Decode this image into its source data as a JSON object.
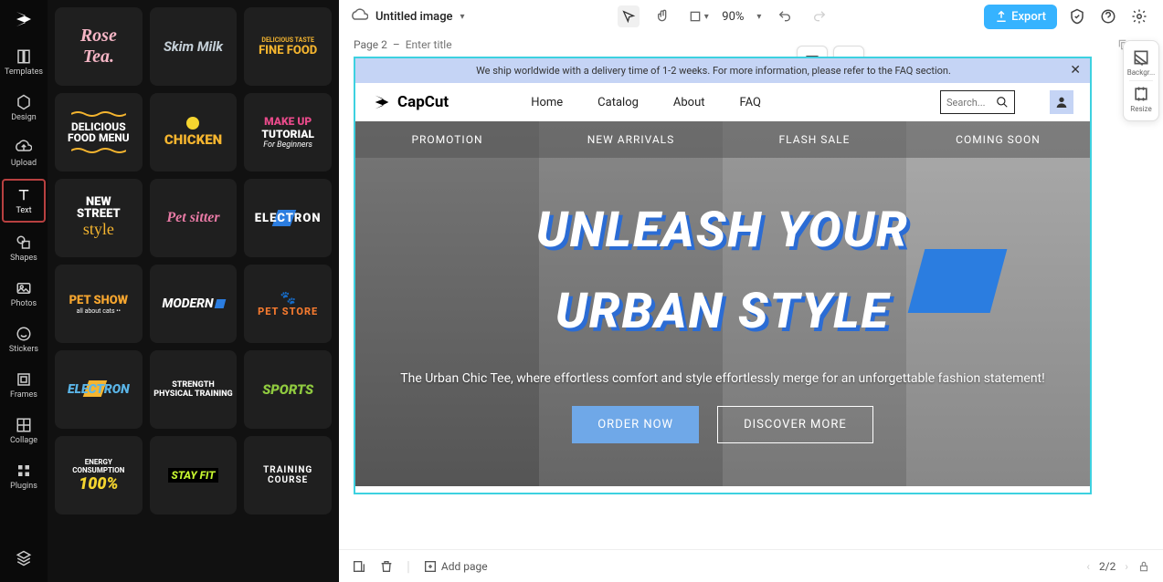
{
  "nav": {
    "templates": "Templates",
    "design": "Design",
    "upload": "Upload",
    "text": "Text",
    "shapes": "Shapes",
    "photos": "Photos",
    "stickers": "Stickers",
    "frames": "Frames",
    "collage": "Collage",
    "plugins": "Plugins"
  },
  "tiles": [
    {
      "l1": "Rose",
      "l2": "Tea.",
      "cls": "t-rose"
    },
    {
      "l1": "Skim Milk",
      "cls": "t-skim"
    },
    {
      "pre": "DELICIOUS TASTE",
      "l1": "FINE FOOD",
      "preCls": "t-fine-sm",
      "cls": "t-fine"
    },
    {
      "l1": "DELICIOUS",
      "l2": "FOOD MENU",
      "cls": "t-deli",
      "wave": true
    },
    {
      "l1": "CHICKEN",
      "cls": "t-chick",
      "egg": true
    },
    {
      "l1": "MAKE UP",
      "l2": "TUTORIAL",
      "l3": "For Beginners",
      "cls": "t-make",
      "cls2": "t-tut",
      "cls3": "t-beg"
    },
    {
      "l1": "NEW",
      "l2": "STREET",
      "l3": "style",
      "cls": "t-street",
      "cls3": "t-style"
    },
    {
      "l1": "Pet sitter",
      "cls": "t-pet"
    },
    {
      "l1": "ELECTRON",
      "cls": "t-elec",
      "slash": "#2b7de0"
    },
    {
      "l1": "PET SHOW",
      "l2": "all about cats ••",
      "cls": "t-petshow",
      "cls2": "t-petshow-sm"
    },
    {
      "l1": "MODERN",
      "cls": "t-modern",
      "sq": "#2b7de0"
    },
    {
      "l1": "PET STORE",
      "cls": "t-petstore",
      "paw": true
    },
    {
      "l1": "ELECTRON",
      "cls": "t-elec2",
      "slash": "#f5b52f"
    },
    {
      "pre": "STRENGTH",
      "l1": "PHYSICAL TRAINING",
      "preCls": "t-phys",
      "cls": "t-phys"
    },
    {
      "l1": "SPORTS",
      "cls": "t-sports"
    },
    {
      "pre": "ENERGY CONSUMPTION",
      "l1": "100%",
      "preCls": "t-energy",
      "cls": "t-100"
    },
    {
      "l1": "STAY FIT",
      "cls": "t-stay"
    },
    {
      "l1": "TRAINING COURSE",
      "cls": "t-train"
    }
  ],
  "topbar": {
    "title": "Untitled image",
    "zoom": "90%",
    "export": "Export"
  },
  "page": {
    "label": "Page 2",
    "sep": "–",
    "placeholder": "Enter title"
  },
  "rightPanel": {
    "backgr": "Backgr...",
    "resize": "Resize"
  },
  "board": {
    "banner": "We ship worldwide with a delivery time of 1-2 weeks. For more information, please refer to the FAQ section.",
    "brand": "CapCut",
    "nav": {
      "home": "Home",
      "catalog": "Catalog",
      "about": "About",
      "faq": "FAQ"
    },
    "searchPlaceholder": "Search...",
    "tabs": {
      "promo": "PROMOTION",
      "new": "NEW ARRIVALS",
      "flash": "FLASH SALE",
      "coming": "COMING SOON"
    },
    "heroTitle1": "UNLEASH YOUR",
    "heroTitle2": "URBAN STYLE",
    "heroSub": "The Urban Chic Tee, where effortless comfort and style effortlessly merge for an unforgettable fashion statement!",
    "order": "ORDER NOW",
    "discover": "DISCOVER MORE"
  },
  "bottom": {
    "addPage": "Add page",
    "pages": "2/2"
  }
}
